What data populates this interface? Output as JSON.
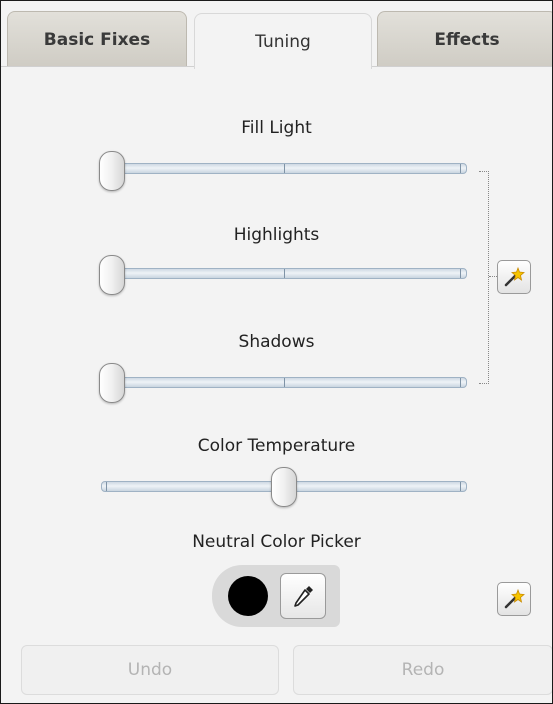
{
  "tabs": [
    {
      "label": "Basic Fixes",
      "active": false
    },
    {
      "label": "Tuning",
      "active": true
    },
    {
      "label": "Effects",
      "active": false
    }
  ],
  "sliders": {
    "fill_light": {
      "label": "Fill Light",
      "value": 0
    },
    "highlights": {
      "label": "Highlights",
      "value": 0
    },
    "shadows": {
      "label": "Shadows",
      "value": 0
    },
    "color_temperature": {
      "label": "Color Temperature",
      "value": 0.5
    }
  },
  "auto_fix_icon": "magic-wand-icon",
  "neutral_picker": {
    "label": "Neutral Color Picker",
    "swatch_color": "#000000",
    "dropper_icon": "eyedropper-icon"
  },
  "actions": {
    "undo_label": "Undo",
    "redo_label": "Redo"
  }
}
